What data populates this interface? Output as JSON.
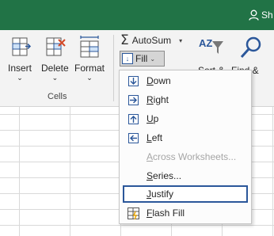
{
  "titlebar": {
    "user_initials": "Sh"
  },
  "ribbon": {
    "insert_label": "Insert",
    "delete_label": "Delete",
    "format_label": "Format",
    "cells_group_label": "Cells",
    "autosum_label": "AutoSum",
    "fill_label": "Fill",
    "sort_label": "Sort &",
    "find_label": "Find &",
    "sort_az": "AZ"
  },
  "fill_menu": {
    "items": [
      {
        "label": "Down",
        "underline": "D",
        "rest": "own",
        "icon": "arrow-down-icon",
        "disabled": false
      },
      {
        "label": "Right",
        "underline": "R",
        "rest": "ight",
        "icon": "arrow-right-icon",
        "disabled": false
      },
      {
        "label": "Up",
        "underline": "U",
        "rest": "p",
        "icon": "arrow-up-icon",
        "disabled": false
      },
      {
        "label": "Left",
        "underline": "L",
        "rest": "eft",
        "icon": "arrow-left-icon",
        "disabled": false
      },
      {
        "label": "Across Worksheets...",
        "underline": "A",
        "rest": "cross Worksheets...",
        "icon": "",
        "disabled": true
      },
      {
        "label": "Series...",
        "underline": "S",
        "rest": "eries...",
        "icon": "",
        "disabled": false
      },
      {
        "label": "Justify",
        "underline": "J",
        "rest": "ustify",
        "icon": "",
        "disabled": false,
        "selected": true
      },
      {
        "label": "Flash Fill",
        "underline": "F",
        "rest": "lash Fill",
        "icon": "flash-fill-icon",
        "disabled": false
      }
    ]
  },
  "colors": {
    "titlebar": "#217346",
    "accent": "#2b579a",
    "delete_x": "#d24726"
  }
}
